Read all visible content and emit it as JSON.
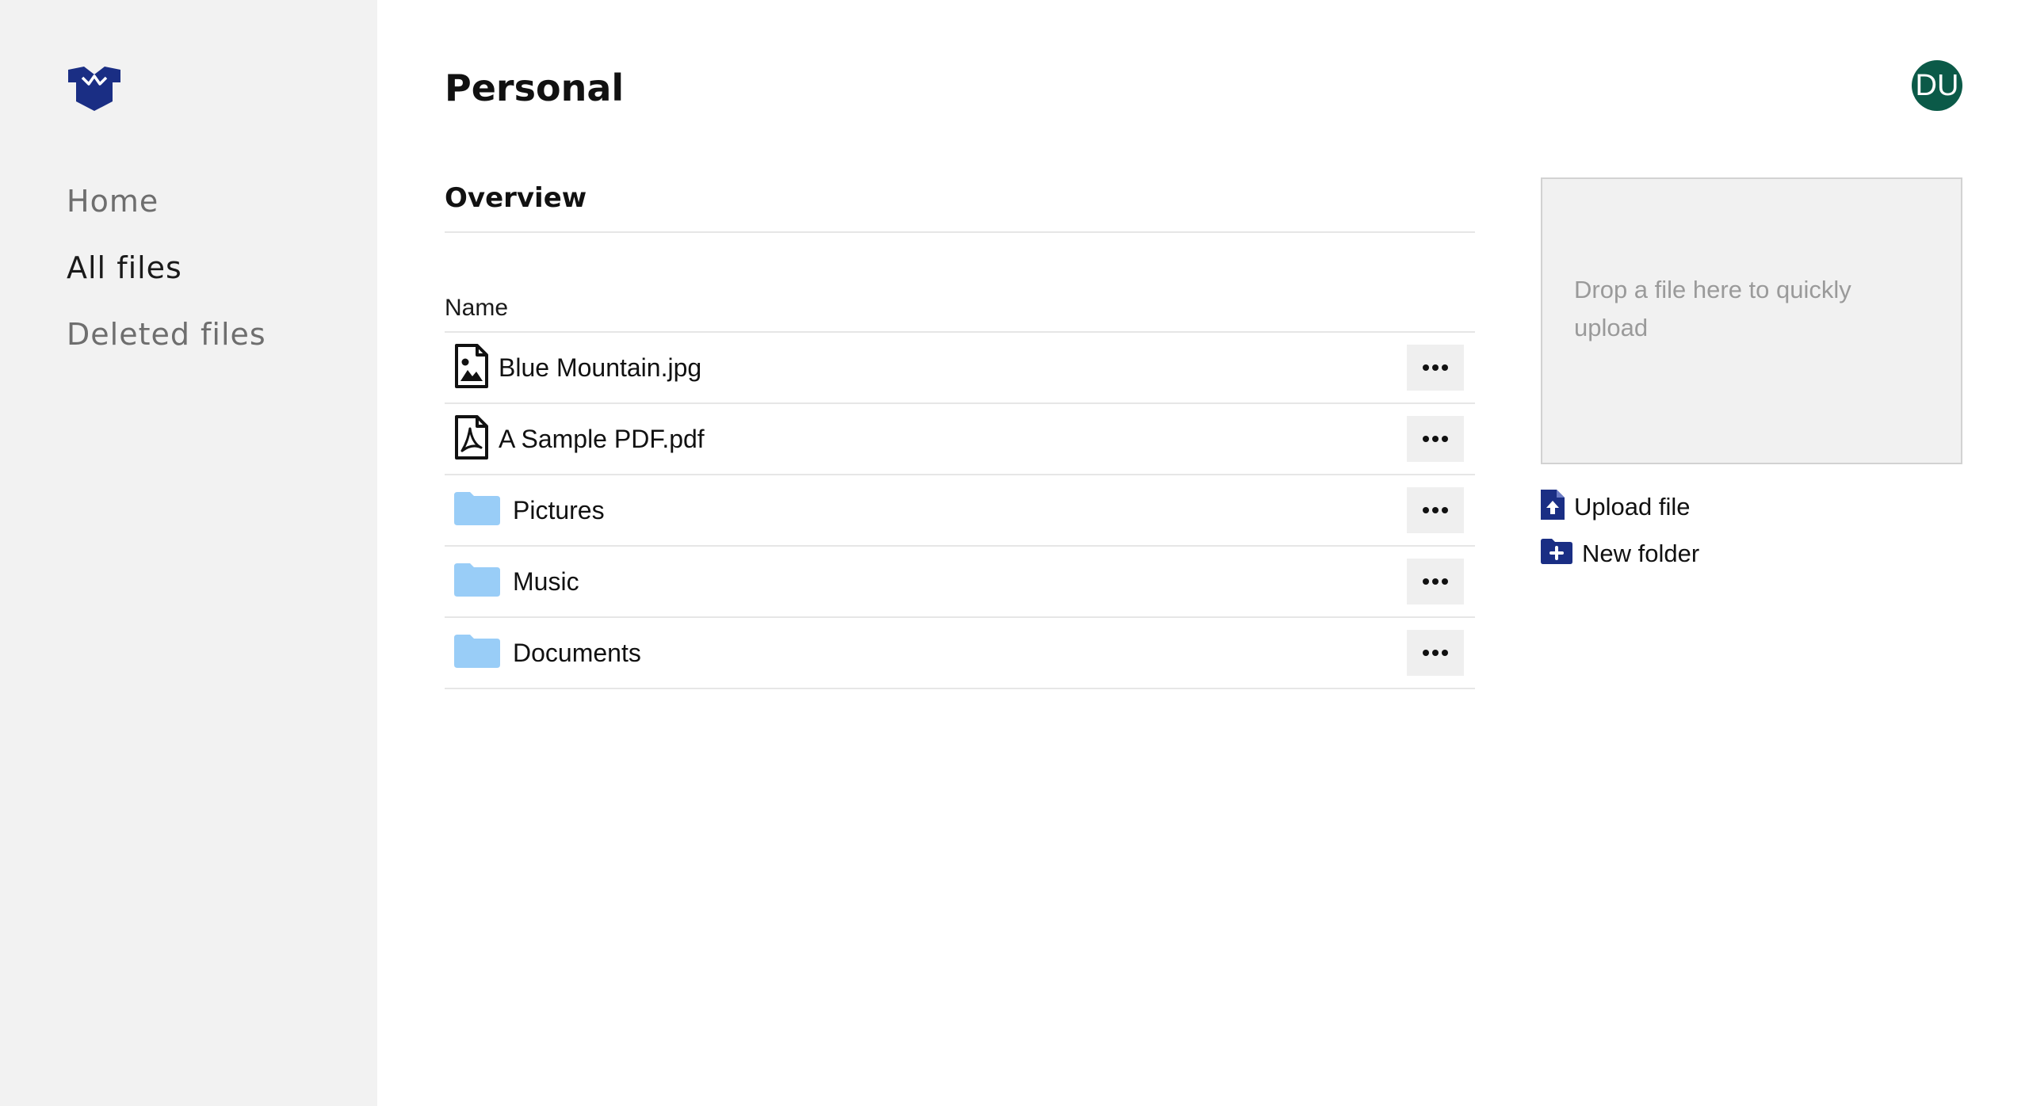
{
  "brand": {
    "logo_icon": "box-icon",
    "accent_color": "#1a2e84"
  },
  "sidebar": {
    "items": [
      {
        "label": "Home",
        "active": false
      },
      {
        "label": "All files",
        "active": true
      },
      {
        "label": "Deleted files",
        "active": false
      }
    ]
  },
  "header": {
    "title": "Personal",
    "avatar_initials": "DU",
    "avatar_color": "#0b5a48"
  },
  "main": {
    "section_title": "Overview",
    "column_header": "Name",
    "rows": [
      {
        "name": "Blue Mountain.jpg",
        "icon": "image-file-icon",
        "menu_icon": "more-horizontal-icon"
      },
      {
        "name": "A Sample PDF.pdf",
        "icon": "pdf-file-icon",
        "menu_icon": "more-horizontal-icon"
      },
      {
        "name": "Pictures",
        "icon": "folder-icon",
        "menu_icon": "more-horizontal-icon"
      },
      {
        "name": "Music",
        "icon": "folder-icon",
        "menu_icon": "more-horizontal-icon"
      },
      {
        "name": "Documents",
        "icon": "folder-icon",
        "menu_icon": "more-horizontal-icon"
      }
    ],
    "folder_color": "#99cdf7"
  },
  "right_panel": {
    "dropzone_text": "Drop a file here to quickly upload",
    "actions": [
      {
        "label": "Upload file",
        "icon": "file-upload-icon"
      },
      {
        "label": "New folder",
        "icon": "folder-plus-icon"
      }
    ]
  }
}
